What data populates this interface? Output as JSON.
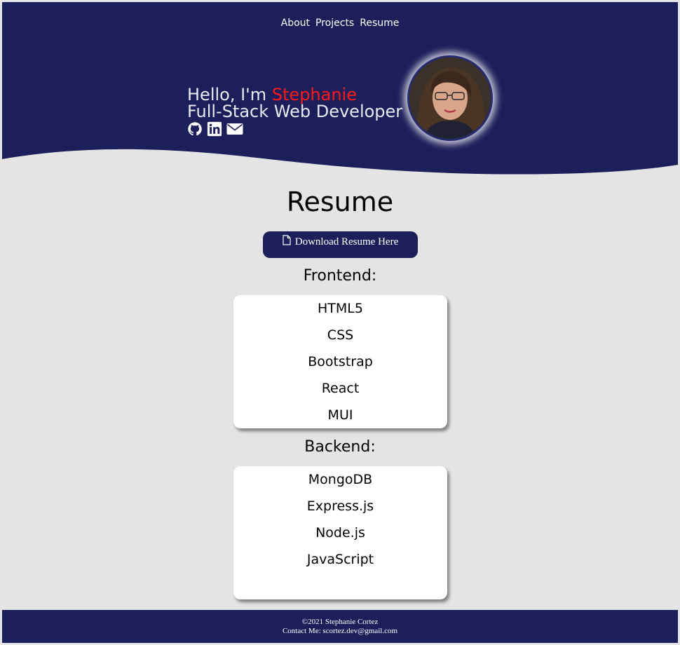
{
  "nav": {
    "items": [
      {
        "label": "About"
      },
      {
        "label": "Projects"
      },
      {
        "label": "Resume"
      }
    ]
  },
  "hero": {
    "greeting": "Hello, I'm ",
    "name": "Stephanie",
    "role": "Full-Stack Web Developer",
    "socials": [
      "github-icon",
      "linkedin-icon",
      "envelope-icon"
    ]
  },
  "resume": {
    "title": "Resume",
    "download_label": "Download Resume Here",
    "download_icon": "file-icon"
  },
  "skills": {
    "frontend_heading": "Frontend:",
    "frontend": [
      "HTML5",
      "CSS",
      "Bootstrap",
      "React",
      "MUI"
    ],
    "backend_heading": "Backend:",
    "backend": [
      "MongoDB",
      "Express.js",
      "Node.js",
      "JavaScript"
    ]
  },
  "footer": {
    "copyright": "©2021 Stephanie Cortez",
    "contact": "Contact Me: scortez.dev@gmail.com"
  },
  "colors": {
    "navy": "#1d1f5b",
    "accent_red": "#ff1a1a",
    "page_bg": "#e4e4e4"
  }
}
